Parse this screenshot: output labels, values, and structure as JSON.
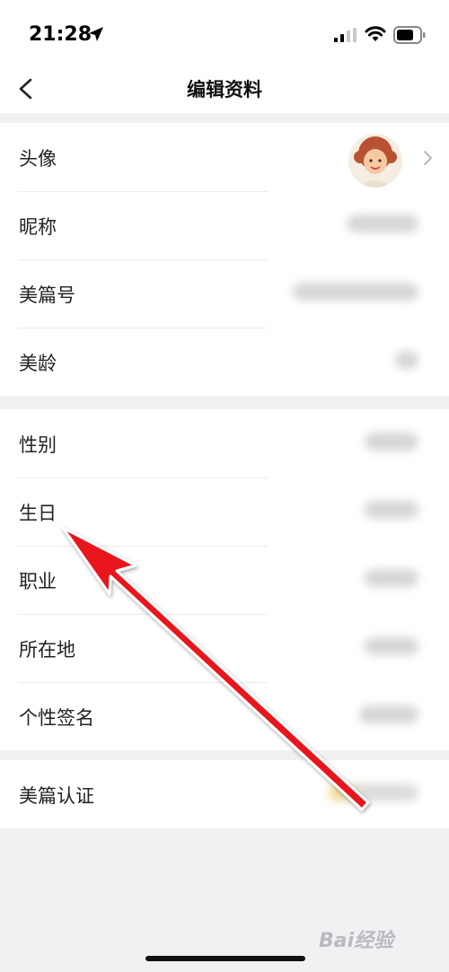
{
  "status_bar": {
    "time": "21:28",
    "icons": [
      "location-arrow-icon",
      "cellular-signal-icon",
      "wifi-icon",
      "battery-icon"
    ]
  },
  "nav": {
    "back_icon": "chevron-left-icon",
    "title": "编辑资料"
  },
  "groups": [
    {
      "rows": [
        {
          "label": "头像",
          "value_type": "avatar"
        },
        {
          "label": "昵称",
          "value_type": "blurred"
        },
        {
          "label": "美篇号",
          "value_type": "blurred"
        },
        {
          "label": "美龄",
          "value_type": "blurred"
        }
      ]
    },
    {
      "rows": [
        {
          "label": "性别",
          "value_type": "blurred"
        },
        {
          "label": "生日",
          "value_type": "blurred"
        },
        {
          "label": "职业",
          "value_type": "blurred"
        },
        {
          "label": "所在地",
          "value_type": "blurred"
        },
        {
          "label": "个性签名",
          "value_type": "blurred"
        }
      ]
    },
    {
      "rows": [
        {
          "label": "美篇认证",
          "value_type": "blurred"
        }
      ]
    }
  ],
  "annotation": {
    "type": "red-arrow",
    "points_to": "生日"
  },
  "watermark": "Bai经验",
  "colors": {
    "background": "#f1f1f3",
    "card": "#ffffff",
    "arrow": "#e8141b"
  }
}
